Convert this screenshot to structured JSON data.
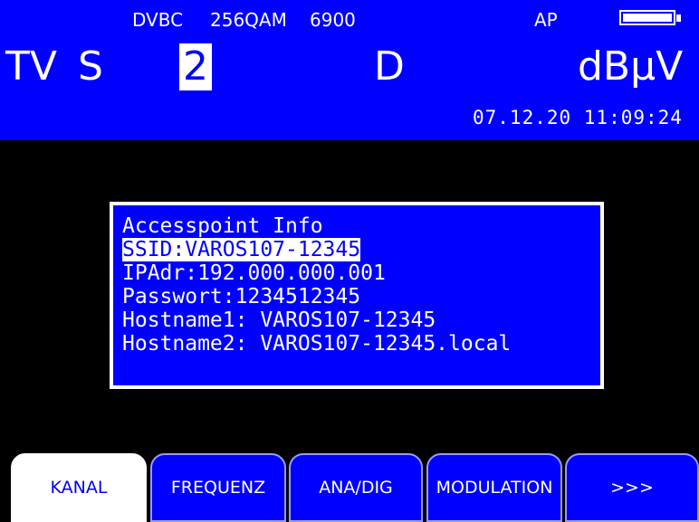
{
  "status": {
    "standard": "DVBC",
    "modulation": "256QAM",
    "symbol_rate": "6900",
    "mode": "AP"
  },
  "main": {
    "band": "TV",
    "system": "S",
    "channel": "2",
    "dmode": "D",
    "unit": "dBμV",
    "datetime": "07.12.20 11:09:24"
  },
  "dialog": {
    "title": "Accesspoint Info",
    "ssid": "SSID:VAROS107-12345",
    "ip": "IPAdr:192.000.000.001",
    "password": "Passwort:1234512345",
    "host1": "Hostname1: VAROS107-12345",
    "host2": "Hostname2: VAROS107-12345.local"
  },
  "softkeys": [
    "KANAL",
    "FREQUENZ",
    "ANA/DIG",
    "MODULATION",
    ">>>"
  ]
}
